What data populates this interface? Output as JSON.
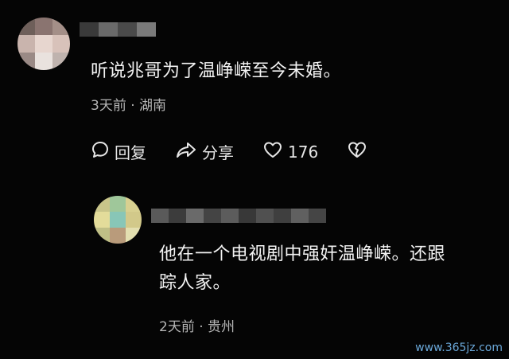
{
  "comments": [
    {
      "text": "听说兆哥为了温峥嵘至今未婚。",
      "time": "3天前",
      "location": "湖南",
      "actions": {
        "reply_label": "回复",
        "share_label": "分享",
        "like_count": "176"
      }
    },
    {
      "text_line1": "他在一个电视剧中强奸温峥嵘。还跟",
      "text_line2": "踪人家。",
      "time": "2天前",
      "location": "贵州"
    }
  ],
  "watermark": "www.365jz.com",
  "icons": [
    "comment-bubble-icon",
    "share-arrow-icon",
    "heart-icon",
    "broken-heart-icon"
  ]
}
